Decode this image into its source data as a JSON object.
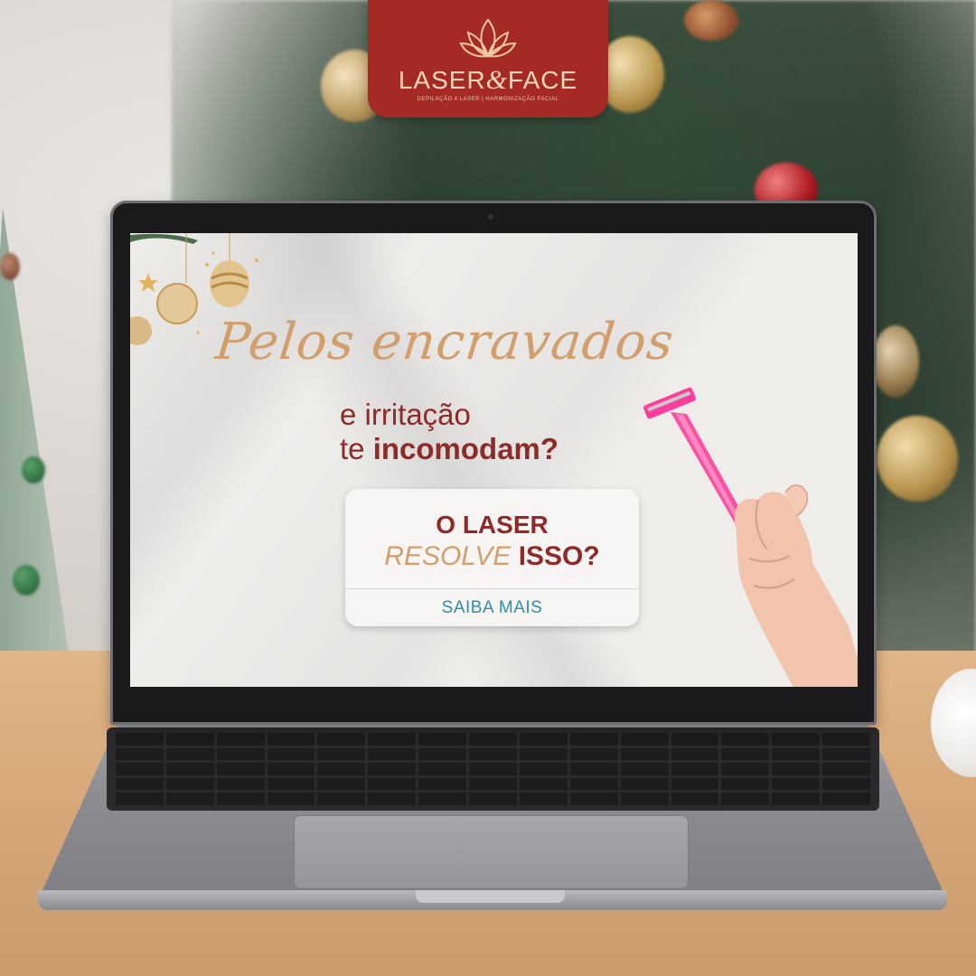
{
  "brand": {
    "name_left": "LASER",
    "name_amp": "&",
    "name_right": "FACE",
    "tagline": "DEPILAÇÃO A LASER | HARMONIZAÇÃO FACIAL",
    "badge_color": "#a52a24"
  },
  "screen": {
    "headline": "Pelos encravados",
    "subline_1": "e irritação",
    "subline_2_regular": "te ",
    "subline_2_bold": "incomodam?",
    "cta": {
      "line_1": "O LASER",
      "line_2_italic": "RESOLVE",
      "line_2_bold": "ISSO?",
      "button_label": "SAIBA MAIS"
    }
  },
  "colors": {
    "gold": "#d29e6c",
    "wine": "#8e2a28",
    "link_blue": "#2d8fa8",
    "razor_pink": "#ff3d9a"
  },
  "icons": [
    "lotus-logo-icon",
    "christmas-bauble-icon",
    "razor-icon",
    "hand-icon"
  ]
}
